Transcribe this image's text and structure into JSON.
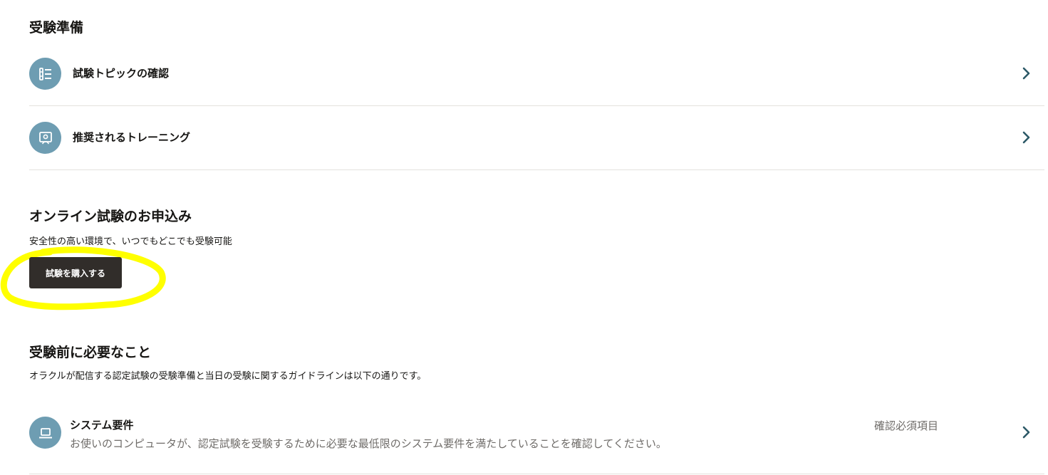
{
  "prep": {
    "title": "受験準備",
    "items": [
      {
        "label": "試験トピックの確認",
        "icon": "list-icon"
      },
      {
        "label": "推奨されるトレーニング",
        "icon": "presenter-icon"
      }
    ]
  },
  "online": {
    "title": "オンライン試験のお申込み",
    "description": "安全性の高い環境で、いつでもどこでも受験可能",
    "buy_button_label": "試験を購入する"
  },
  "before": {
    "title": "受験前に必要なこと",
    "description": "オラクルが配信する認定試験の受験準備と当日の受験に関するガイドラインは以下の通りです。",
    "system": {
      "title": "システム要件",
      "description": "お使いのコンピュータが、認定試験を受験するために必要な最低限のシステム要件を満たしていることを確認してください。",
      "tag": "確認必須項目",
      "icon": "laptop-icon"
    }
  },
  "colors": {
    "icon_bg": "#6e9db2",
    "chevron": "#2c5967",
    "button_bg": "#312d2a",
    "highlight": "#ffff00"
  }
}
